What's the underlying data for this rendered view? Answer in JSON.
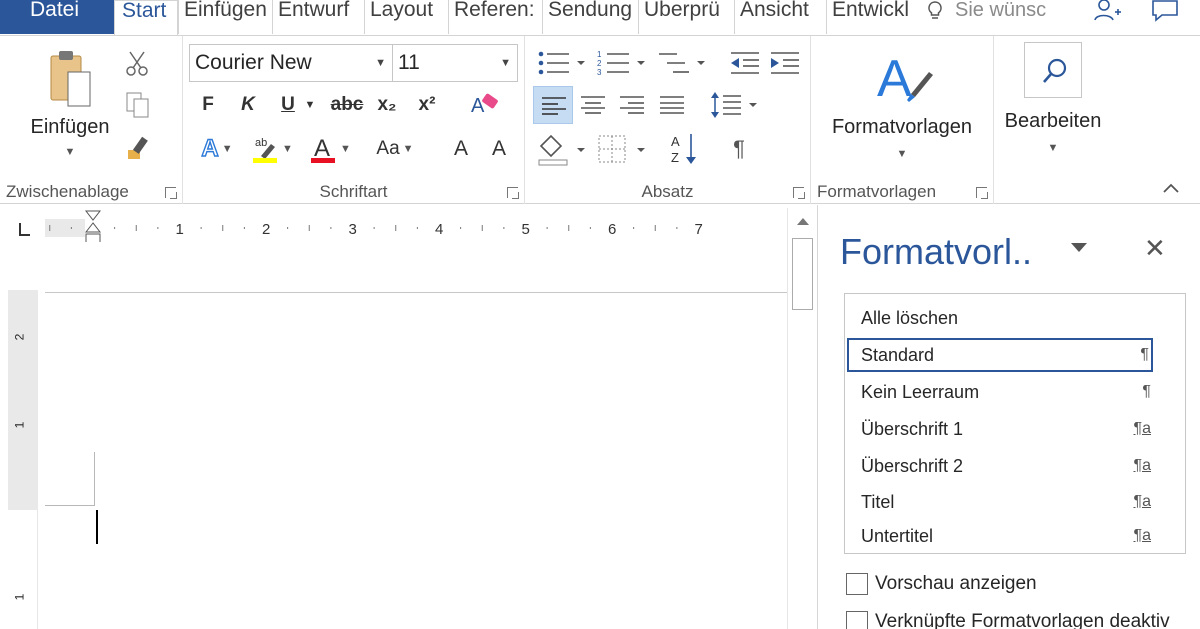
{
  "tabs": {
    "file": "Datei",
    "items": [
      "Start",
      "Einfügen",
      "Entwurf",
      "Layout",
      "Referen:",
      "Sendung",
      "Überprü",
      "Ansicht",
      "Entwickl"
    ],
    "tell_me": "Sie wünsc"
  },
  "clipboard": {
    "paste_label": "Einfügen",
    "group_label": "Zwischenablage"
  },
  "font": {
    "name": "Courier New",
    "size": "11",
    "bold": "F",
    "italic": "K",
    "underline": "U",
    "strike": "abc",
    "sub": "x₂",
    "sup": "x²",
    "case": "Aa",
    "grow": "A",
    "shrink": "A",
    "group_label": "Schriftart"
  },
  "paragraph": {
    "pilcrow": "¶",
    "group_label": "Absatz"
  },
  "styles": {
    "button_label": "Formatvorlagen",
    "group_label": "Formatvorlagen"
  },
  "editing": {
    "button_label": "Bearbeiten"
  },
  "ruler": {
    "marks": [
      "1",
      "2",
      "3",
      "4",
      "5",
      "6",
      "7"
    ],
    "vmarks": [
      "2",
      "1",
      "1"
    ]
  },
  "pane": {
    "title": "Formatvorl..",
    "close": "✕",
    "items": [
      {
        "label": "Alle löschen",
        "mark": ""
      },
      {
        "label": "Standard",
        "mark": "¶"
      },
      {
        "label": "Kein Leerraum",
        "mark": "¶"
      },
      {
        "label": "Überschrift 1",
        "mark": "¶a"
      },
      {
        "label": "Überschrift 2",
        "mark": "¶a"
      },
      {
        "label": "Titel",
        "mark": "¶a"
      },
      {
        "label": "Untertitel",
        "mark": "¶a"
      }
    ],
    "preview_label": "Vorschau anzeigen",
    "linked_label": "Verknüpfte Formatvorlagen deaktiv"
  },
  "colors": {
    "accent": "#2b579a",
    "highlight": "#ffff00",
    "font_color": "#e81123"
  }
}
